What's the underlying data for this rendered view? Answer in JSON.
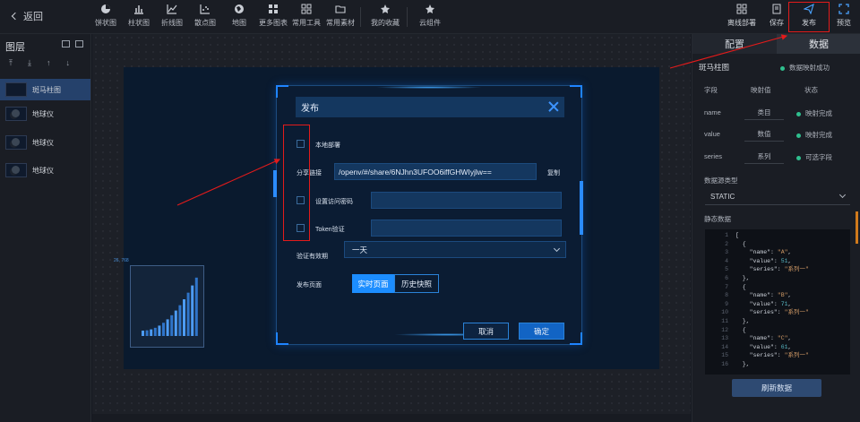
{
  "topbar": {
    "back_label": "返回",
    "tools": [
      "饼状图",
      "柱状图",
      "折线图",
      "散点图",
      "地图",
      "更多图表",
      "常用工具",
      "常用素材",
      "我的收藏",
      "云组件"
    ],
    "right_tools": [
      "离线部署",
      "保存",
      "发布",
      "预览"
    ]
  },
  "layers": {
    "title": "图层",
    "items": [
      {
        "label": "斑马柱图",
        "active": true
      },
      {
        "label": "地球仪",
        "active": false
      },
      {
        "label": "地球仪",
        "active": false
      },
      {
        "label": "地球仪",
        "active": false
      }
    ]
  },
  "publish_dialog": {
    "title": "发布",
    "local_deploy": "本地部署",
    "share_link_label": "分享链接",
    "share_link_value": "/openv/#/share/6NJhn3UFOO6iffGHWIyjlw==",
    "copy_label": "复制",
    "access_password_label": "设置访问密码",
    "token_label": "Token验证",
    "validity_label": "验证有效期",
    "validity_value": "一天",
    "publish_page_label": "发布页面",
    "page_options": [
      "实时页面",
      "历史快照"
    ],
    "cancel_label": "取消",
    "confirm_label": "确定"
  },
  "right_panel": {
    "tabs": [
      "配置",
      "数据"
    ],
    "component_name": "斑马柱图",
    "mapping_status": "数据映射成功",
    "headers": [
      "字段",
      "映射值",
      "状态"
    ],
    "rows": [
      {
        "field": "name",
        "value": "类目",
        "status": "映射完成"
      },
      {
        "field": "value",
        "value": "数值",
        "status": "映射完成"
      },
      {
        "field": "series",
        "value": "系列",
        "status": "可选字段"
      }
    ],
    "source_type_label": "数据源类型",
    "source_type_value": "STATIC",
    "static_data_label": "静态数据",
    "refresh_label": "刷新数据"
  },
  "code_lines": [
    {
      "n": "1",
      "t": "["
    },
    {
      "n": "2",
      "t": "  {"
    },
    {
      "n": "3",
      "t": "    \"name\": \"A\","
    },
    {
      "n": "4",
      "t": "    \"value\": 51,"
    },
    {
      "n": "5",
      "t": "    \"series\": \"系列一\""
    },
    {
      "n": "6",
      "t": "  },"
    },
    {
      "n": "7",
      "t": "  {"
    },
    {
      "n": "8",
      "t": "    \"name\": \"B\","
    },
    {
      "n": "9",
      "t": "    \"value\": 71,"
    },
    {
      "n": "10",
      "t": "    \"series\": \"系列一\""
    },
    {
      "n": "11",
      "t": "  },"
    },
    {
      "n": "12",
      "t": "  {"
    },
    {
      "n": "13",
      "t": "    \"name\": \"C\","
    },
    {
      "n": "14",
      "t": "    \"value\": 61,"
    },
    {
      "n": "15",
      "t": "    \"series\": \"系列一\""
    },
    {
      "n": "16",
      "t": "  },"
    }
  ],
  "canvas_coord_label": "26, 768",
  "colors": {
    "accent": "#2b8cff",
    "annotation": "#e31b1b",
    "active_layer": "#25416b"
  }
}
